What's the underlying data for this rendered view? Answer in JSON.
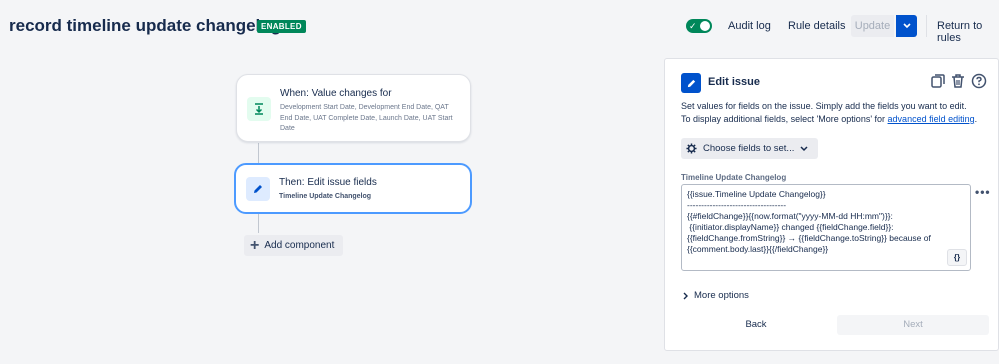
{
  "header": {
    "title": "record timeline update changelog",
    "status_badge": "ENABLED",
    "audit_log": "Audit log",
    "rule_details": "Rule details",
    "update": "Update",
    "return_to_rules": "Return to rules"
  },
  "canvas": {
    "trigger": {
      "title": "When: Value changes for",
      "fields": "Development Start Date, Development End Date, QAT End Date, UAT Complete Date, Launch Date, UAT Start Date"
    },
    "action": {
      "title": "Then: Edit issue fields",
      "field": "Timeline Update Changelog"
    },
    "add_component": "Add component"
  },
  "panel": {
    "title": "Edit issue",
    "description_line1": "Set values for fields on the issue. Simply add the fields you want to edit.",
    "description_line2_prefix": "To display additional fields, select 'More options' for ",
    "description_link": "advanced field editing",
    "description_suffix": ".",
    "choose_fields": "Choose fields to set...",
    "field_label": "Timeline Update Changelog",
    "field_value": "{{issue.Timeline Update Changelog}}\n-----------------------------------\n{{#fieldChange}}{{now.format(\"yyyy-MM-dd HH:mm\")}}:\n {{initiator.displayName}} changed {{fieldChange.field}}:\n{{fieldChange.fromString}} → {{fieldChange.toString}} because of\n{{comment.body.last}}{{/fieldChange}}",
    "smart_values_button": "{}",
    "more_options": "More options",
    "back": "Back",
    "next": "Next"
  },
  "colors": {
    "enabled_green": "#00875a",
    "primary_blue": "#0052cc",
    "selected_border": "#4c9aff"
  }
}
